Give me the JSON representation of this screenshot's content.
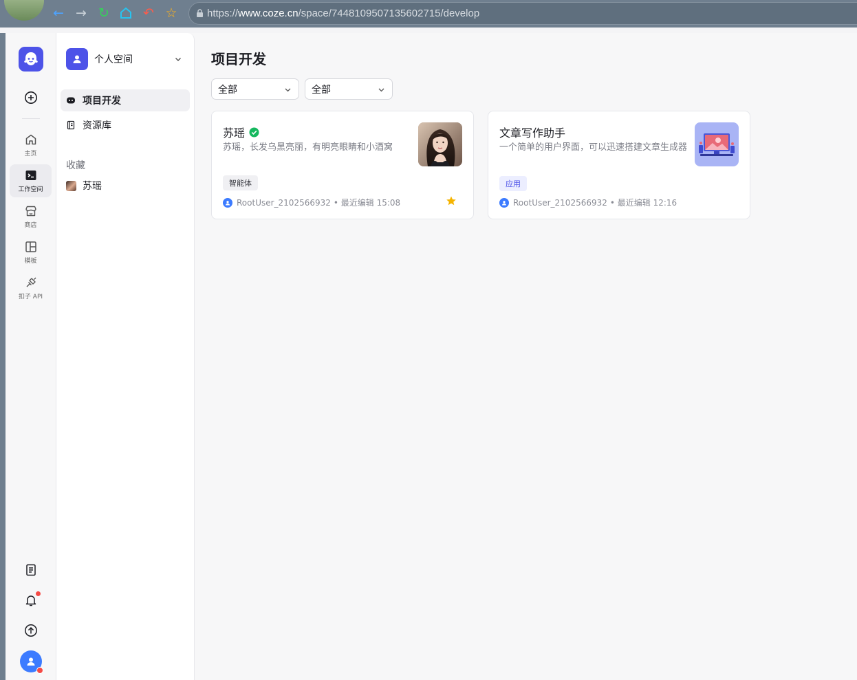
{
  "browser": {
    "url_prefix": "https://",
    "url_domain": "www.coze.cn",
    "url_path": "/space/7448109507135602715/develop",
    "icons": [
      "back-icon",
      "forward-icon",
      "reload-icon",
      "home-icon",
      "undo-icon",
      "star-icon",
      "lock-icon"
    ]
  },
  "rail": {
    "items": [
      {
        "label": "主页",
        "icon": "home-icon"
      },
      {
        "label": "工作空间",
        "icon": "terminal-icon"
      },
      {
        "label": "商店",
        "icon": "store-icon"
      },
      {
        "label": "模板",
        "icon": "template-icon"
      },
      {
        "label": "扣子 API",
        "icon": "api-icon"
      }
    ],
    "active": "工作空间",
    "bottom_icons": [
      "document-icon",
      "bell-icon",
      "upload-icon"
    ],
    "notification_dot_color": "#f54a45"
  },
  "space": {
    "name": "个人空间",
    "menu": [
      {
        "label": "项目开发",
        "icon": "bot-icon"
      },
      {
        "label": "资源库",
        "icon": "library-icon"
      }
    ],
    "favorites_title": "收藏",
    "favorites": [
      {
        "label": "苏瑶"
      }
    ]
  },
  "main": {
    "title": "项目开发",
    "filters": [
      "全部",
      "全部"
    ],
    "cards": [
      {
        "title": "苏瑶",
        "verified": true,
        "description": "苏瑶，长发乌黑亮丽，有明亮眼睛和小酒窝",
        "tag": "智能体",
        "author": "RootUser_2102566932",
        "edited": "• 最近编辑 15:08",
        "starred": true
      },
      {
        "title": "文章写作助手",
        "verified": false,
        "description": "一个简单的用户界面，可以迅速搭建文章生成器",
        "tag": "应用",
        "author": "RootUser_2102566932",
        "edited": "• 最近编辑 12:16",
        "starred": false
      }
    ]
  },
  "colors": {
    "brand": "#4d53e8",
    "verified": "#16b85f",
    "star": "#f5b400",
    "avatar_blue": "#3c7bff"
  }
}
